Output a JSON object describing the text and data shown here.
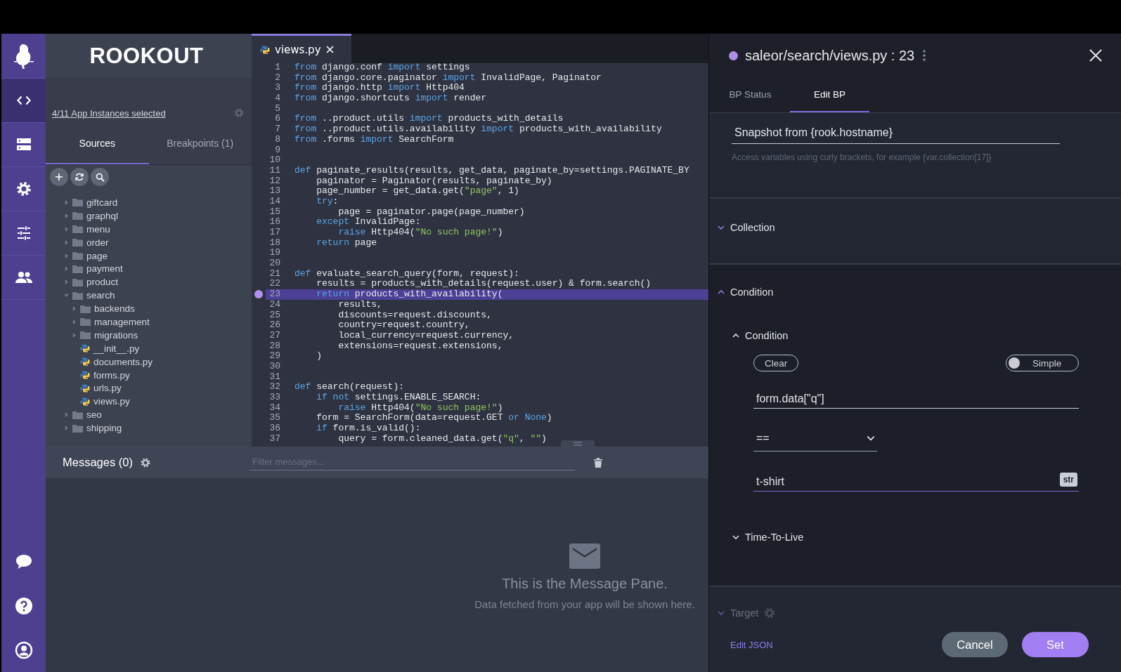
{
  "rail": {
    "items": [
      {
        "kind": "code",
        "selected": true
      },
      {
        "kind": "servers",
        "selected": false
      },
      {
        "kind": "settings",
        "selected": false
      },
      {
        "kind": "sliders",
        "selected": false
      },
      {
        "kind": "team",
        "selected": false
      }
    ],
    "bottom_items": [
      {
        "kind": "chat"
      },
      {
        "kind": "help"
      },
      {
        "kind": "account"
      }
    ]
  },
  "sidebar": {
    "brand": "ROOKOUT",
    "instances_link": "4/11 App Instances selected",
    "tabs": [
      {
        "label": "Sources",
        "selected": true
      },
      {
        "label": "Breakpoints (1)",
        "selected": false
      }
    ],
    "tree": [
      {
        "name": "giftcard",
        "kind": "folder",
        "expanded": false
      },
      {
        "name": "graphql",
        "kind": "folder",
        "expanded": false
      },
      {
        "name": "menu",
        "kind": "folder",
        "expanded": false
      },
      {
        "name": "order",
        "kind": "folder",
        "expanded": false
      },
      {
        "name": "page",
        "kind": "folder",
        "expanded": false
      },
      {
        "name": "payment",
        "kind": "folder",
        "expanded": false
      },
      {
        "name": "product",
        "kind": "folder",
        "expanded": false
      },
      {
        "name": "search",
        "kind": "folder",
        "expanded": true,
        "children": [
          {
            "name": "backends",
            "kind": "folder",
            "expanded": false
          },
          {
            "name": "management",
            "kind": "folder",
            "expanded": false
          },
          {
            "name": "migrations",
            "kind": "folder",
            "expanded": false
          },
          {
            "name": "__init__.py",
            "kind": "file"
          },
          {
            "name": "documents.py",
            "kind": "file"
          },
          {
            "name": "forms.py",
            "kind": "file"
          },
          {
            "name": "urls.py",
            "kind": "file"
          },
          {
            "name": "views.py",
            "kind": "file"
          }
        ]
      },
      {
        "name": "seo",
        "kind": "folder",
        "expanded": false
      },
      {
        "name": "shipping",
        "kind": "folder",
        "expanded": false
      }
    ]
  },
  "editor": {
    "tabs": [
      {
        "label": "views.py",
        "selected": true
      }
    ],
    "lines": [
      {
        "n": "1",
        "breakpoint": false,
        "segments": [
          {
            "text": "from",
            "kind": "keyword"
          },
          {
            "text": " django.conf "
          },
          {
            "text": "import",
            "kind": "keyword"
          },
          {
            "text": " settings"
          }
        ]
      },
      {
        "n": "2",
        "breakpoint": false,
        "segments": [
          {
            "text": "from",
            "kind": "keyword"
          },
          {
            "text": " django.core.paginator "
          },
          {
            "text": "import",
            "kind": "keyword"
          },
          {
            "text": " InvalidPage, Paginator"
          }
        ]
      },
      {
        "n": "3",
        "breakpoint": false,
        "segments": [
          {
            "text": "from",
            "kind": "keyword"
          },
          {
            "text": " django.http "
          },
          {
            "text": "import",
            "kind": "keyword"
          },
          {
            "text": " Http404"
          }
        ]
      },
      {
        "n": "4",
        "breakpoint": false,
        "segments": [
          {
            "text": "from",
            "kind": "keyword"
          },
          {
            "text": " django.shortcuts "
          },
          {
            "text": "import",
            "kind": "keyword"
          },
          {
            "text": " render"
          }
        ]
      },
      {
        "n": "5",
        "breakpoint": false
      },
      {
        "n": "6",
        "breakpoint": false,
        "segments": [
          {
            "text": "from",
            "kind": "keyword"
          },
          {
            "text": " ..product.utils "
          },
          {
            "text": "import",
            "kind": "keyword"
          },
          {
            "text": " products_with_details"
          }
        ]
      },
      {
        "n": "7",
        "breakpoint": false,
        "segments": [
          {
            "text": "from",
            "kind": "keyword"
          },
          {
            "text": " ..product.utils.availability "
          },
          {
            "text": "import",
            "kind": "keyword"
          },
          {
            "text": " products_with_availability"
          }
        ]
      },
      {
        "n": "8",
        "breakpoint": false,
        "segments": [
          {
            "text": "from",
            "kind": "keyword"
          },
          {
            "text": " .forms "
          },
          {
            "text": "import",
            "kind": "keyword"
          },
          {
            "text": " SearchForm"
          }
        ]
      },
      {
        "n": "9",
        "breakpoint": false
      },
      {
        "n": "10",
        "breakpoint": false
      },
      {
        "n": "11",
        "breakpoint": false,
        "segments": [
          {
            "text": "def",
            "kind": "keyword"
          },
          {
            "text": " paginate_results(results, get_data, paginate_by=settings.PAGINATE_BY"
          }
        ]
      },
      {
        "n": "12",
        "breakpoint": false,
        "segments": [
          {
            "text": "    paginator = Paginator(results, paginate_by)"
          }
        ]
      },
      {
        "n": "13",
        "breakpoint": false,
        "segments": [
          {
            "text": "    page_number = get_data.get("
          },
          {
            "text": "\"page\"",
            "kind": "string"
          },
          {
            "text": ", 1)"
          }
        ]
      },
      {
        "n": "14",
        "breakpoint": false,
        "segments": [
          {
            "text": "    try",
            "kind": "keyword"
          },
          {
            "text": ":"
          }
        ]
      },
      {
        "n": "15",
        "breakpoint": false,
        "segments": [
          {
            "text": "        page = paginator.page(page_number)"
          }
        ]
      },
      {
        "n": "16",
        "breakpoint": false,
        "segments": [
          {
            "text": "    except",
            "kind": "keyword"
          },
          {
            "text": " InvalidPage:"
          }
        ]
      },
      {
        "n": "17",
        "breakpoint": false,
        "segments": [
          {
            "text": "        raise",
            "kind": "keyword"
          },
          {
            "text": " Http404("
          },
          {
            "text": "\"No such page!\"",
            "kind": "string"
          },
          {
            "text": ")"
          }
        ]
      },
      {
        "n": "18",
        "breakpoint": false,
        "segments": [
          {
            "text": "    return",
            "kind": "keyword"
          },
          {
            "text": " page"
          }
        ]
      },
      {
        "n": "19",
        "breakpoint": false
      },
      {
        "n": "20",
        "breakpoint": false
      },
      {
        "n": "21",
        "breakpoint": false,
        "segments": [
          {
            "text": "def",
            "kind": "keyword"
          },
          {
            "text": " evaluate_search_query(form, request):"
          }
        ]
      },
      {
        "n": "22",
        "breakpoint": false,
        "segments": [
          {
            "text": "    results = products_with_details(request.user) & form.search()"
          }
        ]
      },
      {
        "n": "23",
        "breakpoint": true,
        "segments": [
          {
            "text": "    return",
            "kind": "keyword"
          },
          {
            "text": " products_with_availability("
          }
        ]
      },
      {
        "n": "24",
        "breakpoint": false,
        "segments": [
          {
            "text": "        results,"
          }
        ]
      },
      {
        "n": "25",
        "breakpoint": false,
        "segments": [
          {
            "text": "        discounts=request.discounts,"
          }
        ]
      },
      {
        "n": "26",
        "breakpoint": false,
        "segments": [
          {
            "text": "        country=request.country,"
          }
        ]
      },
      {
        "n": "27",
        "breakpoint": false,
        "segments": [
          {
            "text": "        local_currency=request.currency,"
          }
        ]
      },
      {
        "n": "28",
        "breakpoint": false,
        "segments": [
          {
            "text": "        extensions=request.extensions,"
          }
        ]
      },
      {
        "n": "29",
        "breakpoint": false,
        "segments": [
          {
            "text": "    )"
          }
        ]
      },
      {
        "n": "30",
        "breakpoint": false
      },
      {
        "n": "31",
        "breakpoint": false
      },
      {
        "n": "32",
        "breakpoint": false,
        "segments": [
          {
            "text": "def",
            "kind": "keyword"
          },
          {
            "text": " search(request):"
          }
        ]
      },
      {
        "n": "33",
        "breakpoint": false,
        "segments": [
          {
            "text": "    if not",
            "kind": "keyword"
          },
          {
            "text": " settings.ENABLE_SEARCH:"
          }
        ]
      },
      {
        "n": "34",
        "breakpoint": false,
        "segments": [
          {
            "text": "        raise",
            "kind": "keyword"
          },
          {
            "text": " Http404("
          },
          {
            "text": "\"No such page!\"",
            "kind": "string"
          },
          {
            "text": ")"
          }
        ]
      },
      {
        "n": "35",
        "breakpoint": false,
        "segments": [
          {
            "text": "    form = SearchForm(data=request.GET "
          },
          {
            "text": "or None",
            "kind": "keyword"
          },
          {
            "text": ")"
          }
        ]
      },
      {
        "n": "36",
        "breakpoint": false,
        "segments": [
          {
            "text": "    if",
            "kind": "keyword"
          },
          {
            "text": " form.is_valid():"
          }
        ]
      },
      {
        "n": "37",
        "breakpoint": false,
        "segments": [
          {
            "text": "        query = form.cleaned_data.get("
          },
          {
            "text": "\"q\"",
            "kind": "string"
          },
          {
            "text": ", "
          },
          {
            "text": "\"\"",
            "kind": "string"
          },
          {
            "text": ")"
          }
        ]
      }
    ]
  },
  "messages": {
    "title": "Messages (0)",
    "filter": {
      "placeholder": "Filter messages..."
    },
    "empty_title": "This is the Message Pane.",
    "empty_text": "Data fetched from your app will be shown here."
  },
  "breakpoint_panel": {
    "title": "saleor/search/views.py : 23",
    "tabs": [
      {
        "label": "BP Status",
        "selected": false
      },
      {
        "label": "Edit BP",
        "selected": true
      }
    ],
    "name_field": {
      "value": "Snapshot from {rook.hostname}"
    },
    "hint": "Access variables using curly brackets, for example {var.collection[17]}",
    "collection": {
      "title": "Collection",
      "expanded": false
    },
    "condition": {
      "title": "Condition",
      "expanded": true,
      "groups": [
        {
          "title": "Condition",
          "expanded": true,
          "clear_button": "Clear",
          "mode_toggle": {
            "label": "Simple",
            "on": false
          },
          "left_operand": {
            "value": "form.data[\"q\"]"
          },
          "operator": {
            "value": "=="
          },
          "right_operand": {
            "value": "t-shirt",
            "type_badge": "str",
            "focused": true
          }
        },
        {
          "title": "Time-To-Live",
          "expanded": false
        }
      ]
    },
    "target": {
      "title": "Target",
      "disabled": true
    },
    "edit_json_link": "Edit JSON",
    "buttons": {
      "cancel": "Cancel",
      "set": "Set"
    }
  }
}
